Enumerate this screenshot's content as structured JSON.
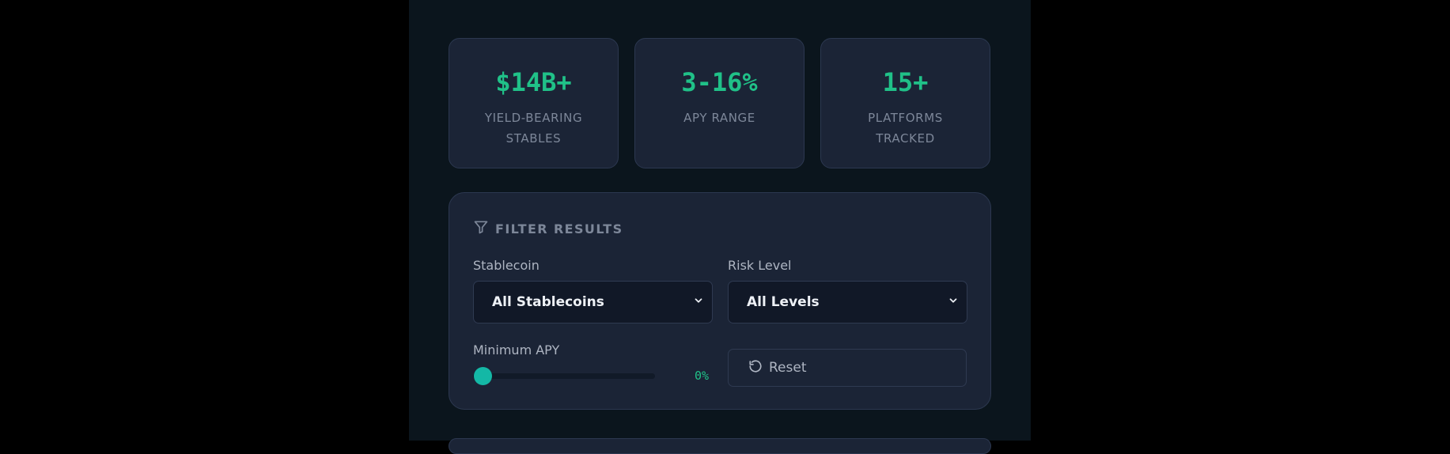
{
  "stats": [
    {
      "value": "$14B+",
      "label": "YIELD-BEARING STABLES"
    },
    {
      "value": "3-16%",
      "label": "APY RANGE"
    },
    {
      "value": "15+",
      "label": "PLATFORMS TRACKED"
    }
  ],
  "filter": {
    "title": "FILTER RESULTS",
    "icon": "filter-icon",
    "stablecoin_label": "Stablecoin",
    "stablecoin_value": "All Stablecoins",
    "risk_label": "Risk Level",
    "risk_value": "All Levels",
    "min_apy_label": "Minimum APY",
    "min_apy_value": "0%",
    "min_apy_fraction": 0,
    "reset_label": "Reset"
  },
  "colors": {
    "accent": "#20c188",
    "slider_thumb": "#14b8a6",
    "card_bg": "#1b2436",
    "page_bg": "#0b151d"
  }
}
